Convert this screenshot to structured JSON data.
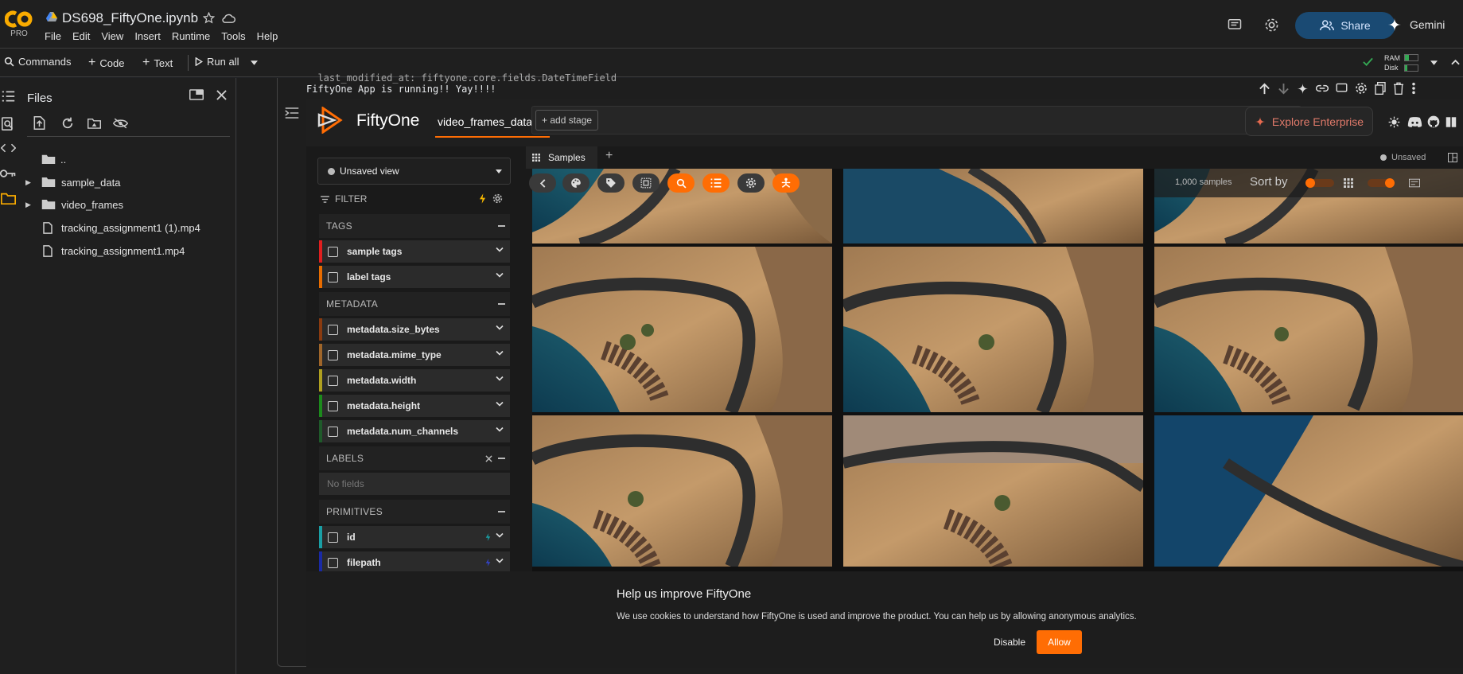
{
  "colab": {
    "logo_badge": "PRO",
    "notebook_title": "DS698_FiftyOne.ipynb",
    "menu": [
      "File",
      "Edit",
      "View",
      "Insert",
      "Runtime",
      "Tools",
      "Help"
    ],
    "toolbar": {
      "commands": "Commands",
      "code": "Code",
      "text": "Text",
      "run_all": "Run all"
    },
    "share_label": "Share",
    "gemini_label": "Gemini",
    "ram_label": "RAM",
    "disk_label": "Disk",
    "accent": "#f9ab00"
  },
  "files_panel": {
    "title": "Files",
    "items": [
      {
        "name": "..",
        "type": "parent"
      },
      {
        "name": "sample_data",
        "type": "folder"
      },
      {
        "name": "video_frames",
        "type": "folder"
      },
      {
        "name": "tracking_assignment1 (1).mp4",
        "type": "file"
      },
      {
        "name": "tracking_assignment1.mp4",
        "type": "file"
      }
    ]
  },
  "cell_output": {
    "line1": "  last_modified_at: fiftyone.core.fields.DateTimeField",
    "line2": "FiftyOne App is running!! Yay!!!!"
  },
  "fiftyone": {
    "brand": "FiftyOne",
    "dataset": "video_frames_dataset",
    "add_stage": "+ add stage",
    "explore_enterprise": "Explore Enterprise",
    "tab_samples": "Samples",
    "unsaved": "Unsaved",
    "view_select": "Unsaved view",
    "filter_label": "FILTER",
    "samples_count": "1,000 samples",
    "sort_by": "Sort by",
    "orange": "#ff6d04",
    "groups": {
      "tags": "TAGS",
      "metadata": "METADATA",
      "labels": "LABELS",
      "labels_empty": "No fields",
      "primitives": "PRIMITIVES"
    },
    "tags_fields": [
      "sample tags",
      "label tags"
    ],
    "metadata_fields": [
      "metadata.size_bytes",
      "metadata.mime_type",
      "metadata.width",
      "metadata.height",
      "metadata.num_channels"
    ],
    "primitive_fields": [
      "id",
      "filepath"
    ],
    "banner": {
      "title": "Help us improve FiftyOne",
      "text": "We use cookies to understand how FiftyOne is used and improve the product. You can help us by allowing anonymous analytics.",
      "disable": "Disable",
      "allow": "Allow"
    }
  }
}
